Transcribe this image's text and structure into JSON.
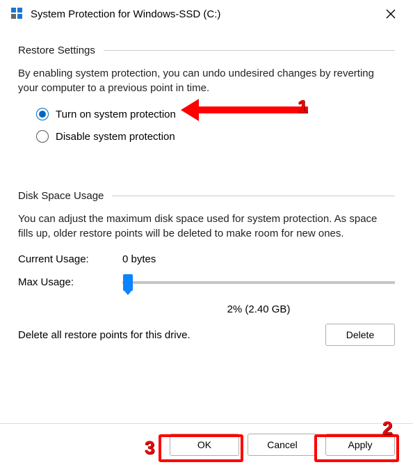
{
  "window": {
    "title": "System Protection for Windows-SSD (C:)"
  },
  "restore": {
    "header": "Restore Settings",
    "description": "By enabling system protection, you can undo undesired changes by reverting your computer to a previous point in time.",
    "option_on": "Turn on system protection",
    "option_off": "Disable system protection"
  },
  "disk": {
    "header": "Disk Space Usage",
    "description": "You can adjust the maximum disk space used for system protection. As space fills up, older restore points will be deleted to make room for new ones.",
    "current_usage_label": "Current Usage:",
    "current_usage_value": "0 bytes",
    "max_usage_label": "Max Usage:",
    "slider_value_text": "2% (2.40 GB)",
    "delete_text": "Delete all restore points for this drive.",
    "delete_button": "Delete"
  },
  "buttons": {
    "ok": "OK",
    "cancel": "Cancel",
    "apply": "Apply"
  },
  "annotations": {
    "n1": "1",
    "n2": "2",
    "n3": "3"
  }
}
